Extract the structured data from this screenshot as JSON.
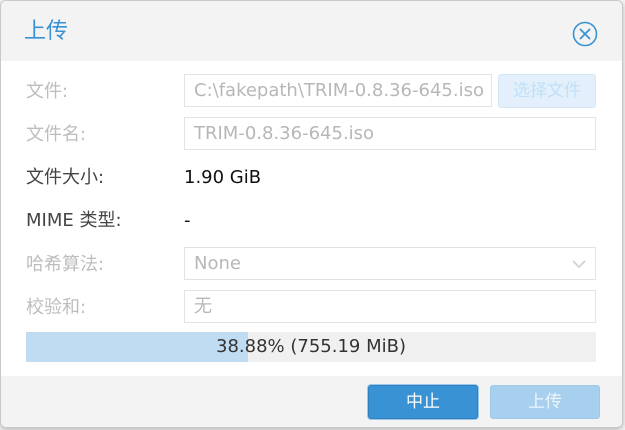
{
  "dialog": {
    "title": "上传"
  },
  "form": {
    "file_label": "文件:",
    "file_value": "C:\\fakepath\\TRIM-0.8.36-645.iso",
    "choose_file_label": "选择文件",
    "filename_label": "文件名:",
    "filename_value": "TRIM-0.8.36-645.iso",
    "filesize_label": "文件大小:",
    "filesize_value": "1.90 GiB",
    "mime_label": "MIME 类型:",
    "mime_value": "-",
    "hash_label": "哈希算法:",
    "hash_value": "None",
    "checksum_label": "校验和:",
    "checksum_placeholder": "无"
  },
  "progress": {
    "fraction": 0.3888,
    "text": "38.88% (755.19 MiB)"
  },
  "footer": {
    "abort_label": "中止",
    "upload_label": "上传"
  },
  "colors": {
    "accent": "#3892d4",
    "progress_fill": "#bfdcf3"
  }
}
